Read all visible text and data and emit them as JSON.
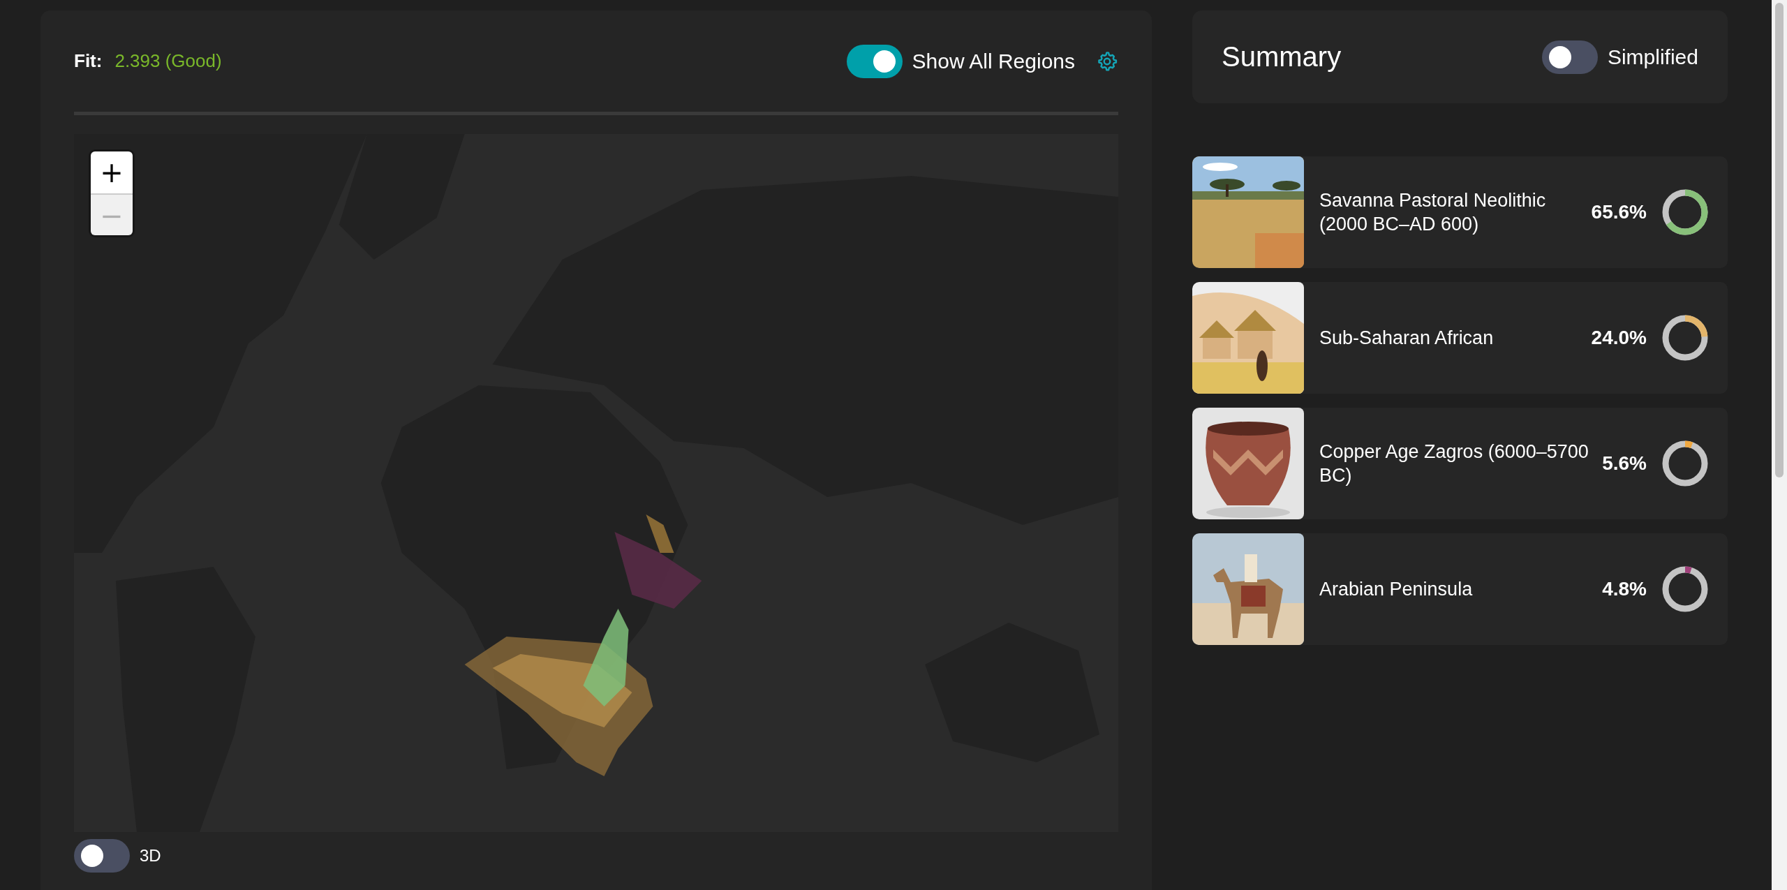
{
  "fit": {
    "label": "Fit:",
    "value": "2.393 (Good)"
  },
  "show_all_regions": {
    "label": "Show All Regions",
    "on": true
  },
  "map": {
    "zoom_in": {
      "label": "+",
      "disabled": false
    },
    "zoom_out": {
      "label": "−",
      "disabled": true
    }
  },
  "three_d": {
    "label": "3D",
    "on": false
  },
  "summary": {
    "title": "Summary",
    "simplified": {
      "label": "Simplified",
      "on": false
    }
  },
  "regions": [
    {
      "name": "Savanna Pastoral Neolithic (2000 BC–AD 600)",
      "percent": "65.6%",
      "level": 0.656,
      "color": "#88c07a"
    },
    {
      "name": "Sub-Saharan African",
      "percent": "24.0%",
      "level": 0.24,
      "color": "#e3b56b"
    },
    {
      "name": "Copper Age Zagros (6000–5700 BC)",
      "percent": "5.6%",
      "level": 0.056,
      "color": "#f0a840"
    },
    {
      "name": "Arabian Peninsula",
      "percent": "4.8%",
      "level": 0.048,
      "color": "#a0407a"
    }
  ]
}
